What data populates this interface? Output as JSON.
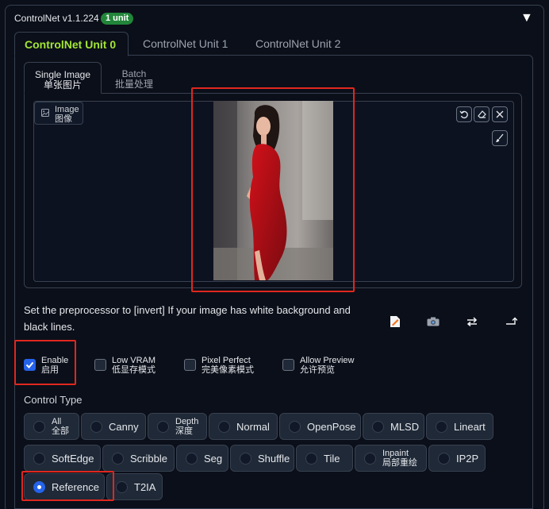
{
  "header": {
    "title": "ControlNet v1.1.224",
    "badge": "1 unit",
    "collapse_icon": "triangle-down-icon"
  },
  "unit_tabs": [
    {
      "label": "ControlNet Unit 0",
      "active": true
    },
    {
      "label": "ControlNet Unit 1",
      "active": false
    },
    {
      "label": "ControlNet Unit 2",
      "active": false
    }
  ],
  "image_tabs": [
    {
      "line1": "Single Image",
      "line2": "单张图片",
      "active": true
    },
    {
      "line1": "Batch",
      "line2": "批量处理",
      "active": false
    }
  ],
  "canvas": {
    "label_line1": "Image",
    "label_line2": "图像",
    "tools": [
      "undo-icon",
      "eraser-icon",
      "close-icon",
      "brush-icon"
    ]
  },
  "hint_text": "Set the preprocessor to [invert] If your image has white background and black lines.",
  "action_icons": [
    "edit-image-icon",
    "camera-icon",
    "swap-icon",
    "send-dimensions-icon"
  ],
  "options": [
    {
      "line1": "Enable",
      "line2": "启用",
      "checked": true
    },
    {
      "line1": "Low VRAM",
      "line2": "低显存模式",
      "checked": false
    },
    {
      "line1": "Pixel Perfect",
      "line2": "完美像素模式",
      "checked": false
    },
    {
      "line1": "Allow Preview",
      "line2": "允许预览",
      "checked": false
    }
  ],
  "control_type": {
    "label": "Control Type",
    "selected": "Reference",
    "row1": [
      {
        "line1": "All",
        "line2": "全部"
      },
      {
        "line1": "Canny"
      },
      {
        "line1": "Depth",
        "line2": "深度"
      },
      {
        "line1": "Normal"
      },
      {
        "line1": "OpenPose"
      },
      {
        "line1": "MLSD"
      },
      {
        "line1": "Lineart"
      }
    ],
    "row2": [
      {
        "line1": "SoftEdge"
      },
      {
        "line1": "Scribble"
      },
      {
        "line1": "Seg"
      },
      {
        "line1": "Shuffle"
      },
      {
        "line1": "Tile"
      },
      {
        "line1": "Inpaint",
        "line2": "局部重绘"
      },
      {
        "line1": "IP2P"
      }
    ],
    "row3": [
      {
        "line1": "Reference"
      },
      {
        "line1": "T2IA"
      }
    ]
  },
  "colors": {
    "background": "#0b0f19",
    "accent_green": "#a3e635",
    "badge_green": "#22863a",
    "checkbox_blue": "#2563eb",
    "highlight_red": "#e0271f"
  }
}
